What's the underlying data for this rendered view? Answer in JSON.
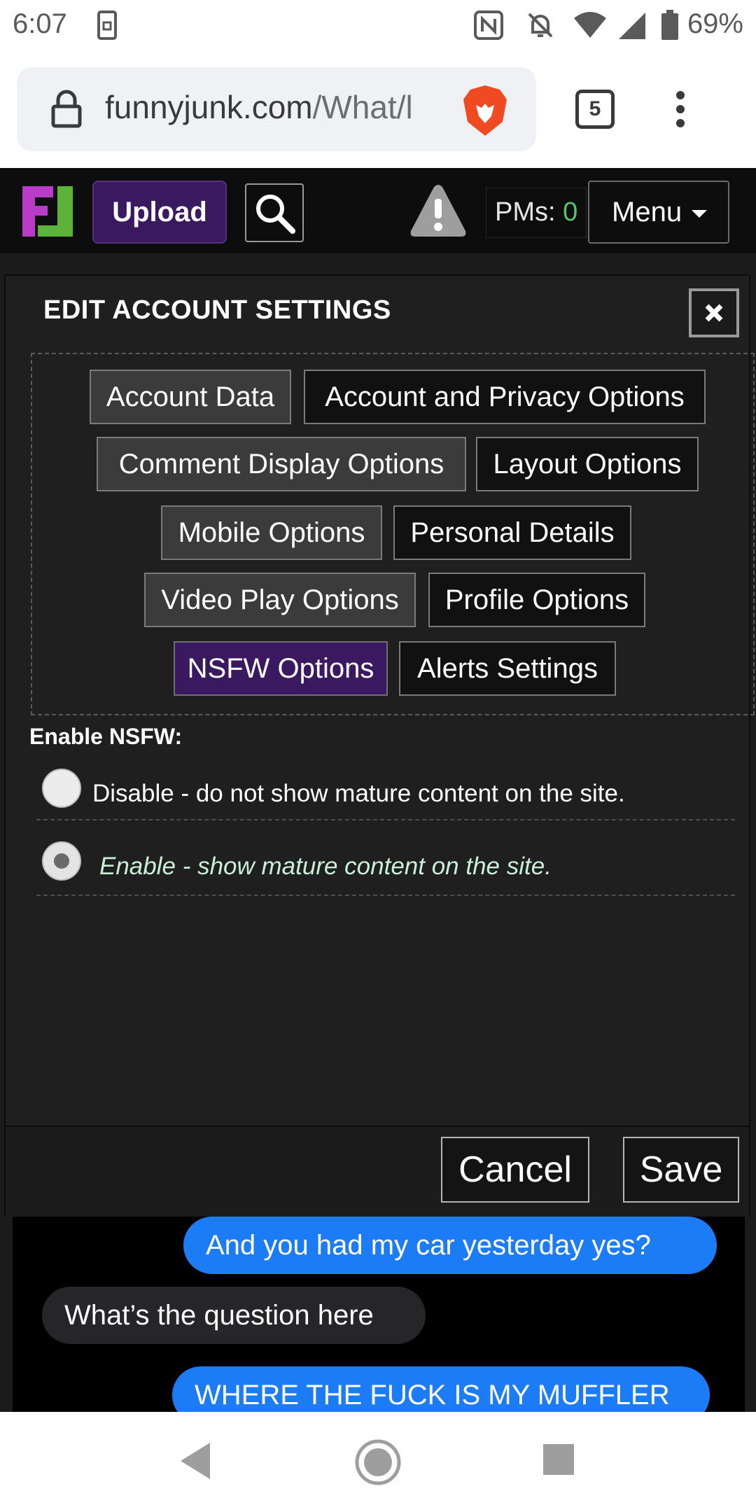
{
  "status_bar": {
    "time": "6:07",
    "battery_percent": "69%",
    "icons": [
      "screenshot-icon",
      "nfc-icon",
      "bell-off-icon",
      "wifi-icon",
      "signal-icon",
      "battery-icon"
    ]
  },
  "browser": {
    "url_domain": "funnyjunk.com",
    "url_path": "/What/l",
    "tab_count": "5",
    "icons": [
      "lock-icon",
      "brave-lion-icon",
      "more-vert-icon"
    ]
  },
  "site_header": {
    "upload_label": "Upload",
    "pms_label": "PMs:",
    "pms_count": "0",
    "menu_label": "Menu",
    "colors": {
      "accent": "#3a1960",
      "pm_count": "#5cc26b"
    }
  },
  "modal": {
    "title": "EDIT ACCOUNT SETTINGS",
    "tabs": [
      {
        "label": "Account Data",
        "style": "gray"
      },
      {
        "label": "Account and Privacy Options",
        "style": "dark"
      },
      {
        "label": "Comment Display Options",
        "style": "gray"
      },
      {
        "label": "Layout Options",
        "style": "dark"
      },
      {
        "label": "Mobile Options",
        "style": "gray"
      },
      {
        "label": "Personal Details",
        "style": "dark"
      },
      {
        "label": "Video Play Options",
        "style": "gray"
      },
      {
        "label": "Profile Options",
        "style": "dark"
      },
      {
        "label": "NSFW Options",
        "style": "active"
      },
      {
        "label": "Alerts Settings",
        "style": "dark"
      }
    ],
    "nsfw_label": "Enable NSFW:",
    "options": [
      {
        "label": "Disable - do not show mature content on the site.",
        "selected": false
      },
      {
        "label": "Enable - show mature content on the site.",
        "selected": true
      }
    ],
    "cancel_label": "Cancel",
    "save_label": "Save"
  },
  "chat": {
    "messages": [
      {
        "text": "And you had my car yesterday yes?",
        "side": "right"
      },
      {
        "text": "What’s the question here",
        "side": "left"
      },
      {
        "text": "WHERE THE FUCK IS MY MUFFLER",
        "side": "right"
      }
    ]
  }
}
